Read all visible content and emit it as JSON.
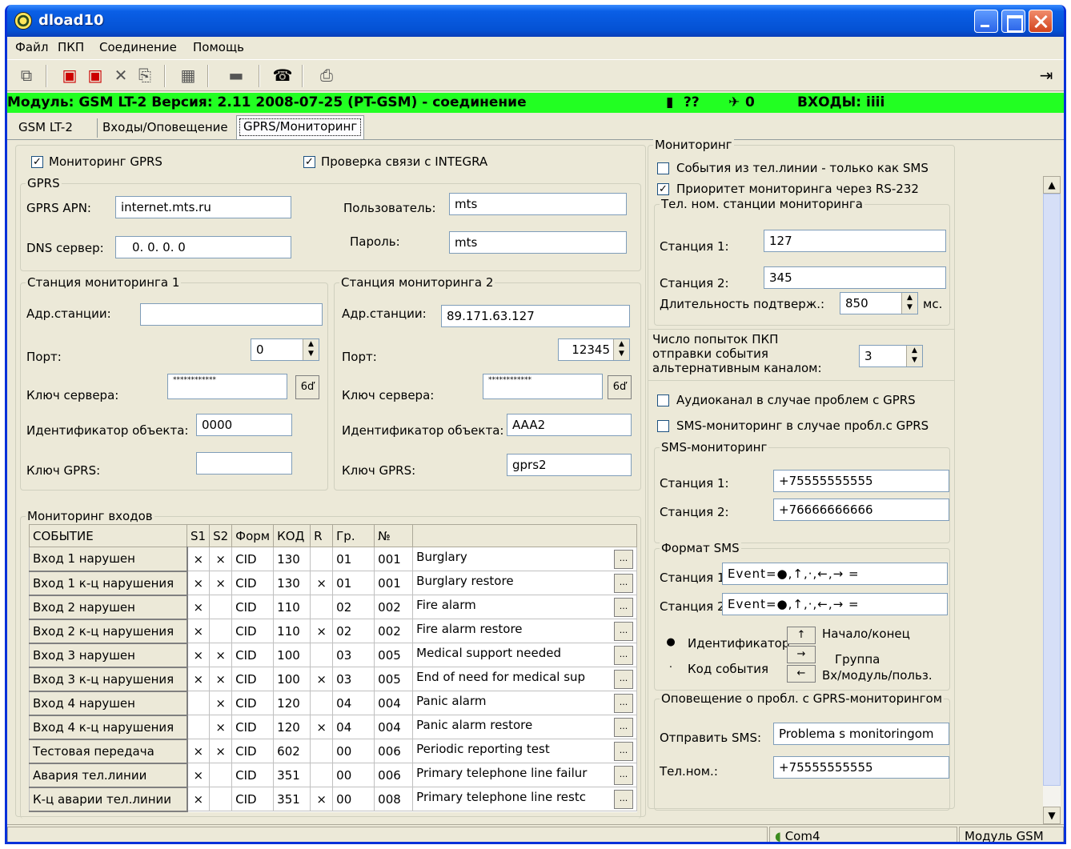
{
  "window": {
    "title": "dload10"
  },
  "menu": [
    "Файл",
    "ПКП",
    "Соединение",
    "Помощь"
  ],
  "status_line": {
    "module": "Модуль: GSM LT-2 Версия: 2.11 2008-07-25 (PT-GSM)  -  соединение",
    "signal": "??",
    "satellite": "0",
    "inputs": "ВХОДЫ: iiii",
    "color": "#22ff22"
  },
  "tabs": [
    "GSM LT-2",
    "Входы/Оповещение",
    "GPRS/Мониторинг"
  ],
  "gprs_top": {
    "mon_gprs": "Мониторинг GPRS",
    "check_integra": "Проверка связи с INTEGRA"
  },
  "gprs": {
    "legend": "GPRS",
    "apn_label": "GPRS APN:",
    "apn": "internet.mts.ru",
    "user_label": "Пользователь:",
    "user": "mts",
    "dns_label": "DNS сервер:",
    "dns": "0.   0.   0.   0",
    "pass_label": "Пароль:",
    "pass": "mts"
  },
  "st1": {
    "legend": "Станция мониторинга 1",
    "addr_label": "Адр.станции:",
    "addr": "",
    "port_label": "Порт:",
    "port": "0",
    "key_label": "Ключ сервера:",
    "key": "************",
    "id_label": "Идентификатор объекта:",
    "id": "0000",
    "gkey_label": "Ключ GPRS:",
    "gkey": ""
  },
  "st2": {
    "legend": "Станция мониторинга 2",
    "addr_label": "Адр.станции:",
    "addr": "89.171.63.127",
    "port_label": "Порт:",
    "port": "12345",
    "key_label": "Ключ сервера:",
    "key": "************",
    "id_label": "Идентификатор объекта:",
    "id": "AAA2",
    "gkey_label": "Ключ GPRS:",
    "gkey": "gprs2"
  },
  "inputs_mon": {
    "legend": "Мониторинг входов",
    "headers": [
      "СОБЫТИЕ",
      "S1",
      "S2",
      "Форм",
      "КОД",
      "R",
      "Гр.",
      "№",
      ""
    ],
    "rows": [
      {
        "ev": "Вход 1 нарушен",
        "s1": "×",
        "s2": "×",
        "f": "CID",
        "code": "130",
        "r": "",
        "gr": "01",
        "n": "001",
        "desc": "Burglary"
      },
      {
        "ev": "Вход 1 к-ц нарушения",
        "s1": "×",
        "s2": "×",
        "f": "CID",
        "code": "130",
        "r": "×",
        "gr": "01",
        "n": "001",
        "desc": "Burglary restore"
      },
      {
        "ev": "Вход 2 нарушен",
        "s1": "×",
        "s2": "",
        "f": "CID",
        "code": "110",
        "r": "",
        "gr": "02",
        "n": "002",
        "desc": "Fire alarm"
      },
      {
        "ev": "Вход 2 к-ц нарушения",
        "s1": "×",
        "s2": "",
        "f": "CID",
        "code": "110",
        "r": "×",
        "gr": "02",
        "n": "002",
        "desc": "Fire alarm restore"
      },
      {
        "ev": "Вход 3 нарушен",
        "s1": "×",
        "s2": "×",
        "f": "CID",
        "code": "100",
        "r": "",
        "gr": "03",
        "n": "005",
        "desc": "Medical support needed"
      },
      {
        "ev": "Вход 3 к-ц нарушения",
        "s1": "×",
        "s2": "×",
        "f": "CID",
        "code": "100",
        "r": "×",
        "gr": "03",
        "n": "005",
        "desc": "End of need for medical sup"
      },
      {
        "ev": "Вход 4 нарушен",
        "s1": "",
        "s2": "×",
        "f": "CID",
        "code": "120",
        "r": "",
        "gr": "04",
        "n": "004",
        "desc": "Panic alarm"
      },
      {
        "ev": "Вход 4 к-ц нарушения",
        "s1": "",
        "s2": "×",
        "f": "CID",
        "code": "120",
        "r": "×",
        "gr": "04",
        "n": "004",
        "desc": "Panic alarm restore"
      },
      {
        "ev": "Тестовая передача",
        "s1": "×",
        "s2": "×",
        "f": "CID",
        "code": "602",
        "r": "",
        "gr": "00",
        "n": "006",
        "desc": "Periodic reporting test"
      },
      {
        "ev": "Авария тел.линии",
        "s1": "×",
        "s2": "",
        "f": "CID",
        "code": "351",
        "r": "",
        "gr": "00",
        "n": "006",
        "desc": "Primary telephone line failur"
      },
      {
        "ev": "К-ц аварии тел.линии",
        "s1": "×",
        "s2": "",
        "f": "CID",
        "code": "351",
        "r": "×",
        "gr": "00",
        "n": "008",
        "desc": "Primary telephone line restc"
      }
    ]
  },
  "monitoring": {
    "legend": "Мониторинг",
    "sms_only": "События из тел.линии - только как SMS",
    "rs232": "Приоритет мониторинга через RS-232"
  },
  "phone": {
    "legend": "Тел. ном. станции мониторинга",
    "st1_label": "Станция 1:",
    "st1": "127",
    "st2_label": "Станция 2:",
    "st2": "345",
    "dur_label": "Длительность подтверж.:",
    "dur": "850",
    "unit": "мс."
  },
  "attempts": {
    "label1": "Число попыток ПКП",
    "label2": "отправки события",
    "label3": "альтернативным каналом:",
    "value": "3"
  },
  "alt": {
    "audio": "Аудиоканал в случае проблем с GPRS",
    "sms": "SMS-мониторинг в случае пробл.с GPRS"
  },
  "sms_mon": {
    "legend": "SMS-мониторинг",
    "st1_label": "Станция 1:",
    "st1": "+75555555555",
    "st2_label": "Станция 2:",
    "st2": "+76666666666"
  },
  "sms_fmt": {
    "legend": "Формат SMS",
    "st1_label": "Станция 1",
    "st1": "Event=●,↑,·,←,→ =",
    "st2_label": "Станция 2",
    "st2": "Event=●,↑,·,←,→ =",
    "b_id": "●",
    "b_id_label": "Идентификатор",
    "b_code": "·",
    "b_code_label": "Код события",
    "b_up": "↑",
    "b_up_label": "Начало/конец",
    "b_right": "→",
    "b_right_label": "Группа",
    "b_left": "←",
    "b_left_label": "Вх/модуль/польз."
  },
  "notify": {
    "legend": "Оповещение о пробл. с GPRS-мониторингом",
    "sms_label": "Отправить SMS:",
    "sms": "Problema s monitoringom",
    "tel_label": "Тел.ном.:",
    "tel": "+75555555555"
  },
  "statusbar": {
    "port": "Com4",
    "module": "Модуль GSM"
  }
}
